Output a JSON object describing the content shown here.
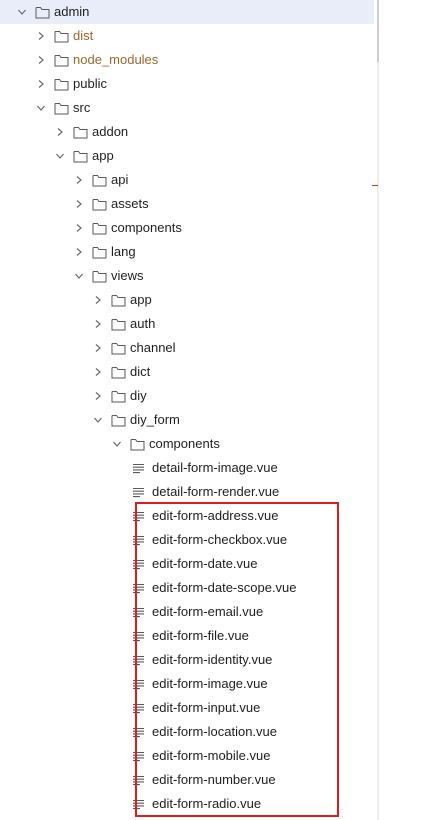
{
  "accent_colors": {
    "selected_row_bg": "#e8edf9",
    "ignored_text": "#a0662b",
    "highlight_border": "#dd1c1c"
  },
  "tree": [
    {
      "label": "admin",
      "type": "folder",
      "depth": 0,
      "expanded": true,
      "selected": true
    },
    {
      "label": "dist",
      "type": "folder",
      "depth": 1,
      "expanded": false,
      "ignored": true
    },
    {
      "label": "node_modules",
      "type": "folder",
      "depth": 1,
      "expanded": false,
      "ignored": true
    },
    {
      "label": "public",
      "type": "folder",
      "depth": 1,
      "expanded": false
    },
    {
      "label": "src",
      "type": "folder",
      "depth": 1,
      "expanded": true
    },
    {
      "label": "addon",
      "type": "folder",
      "depth": 2,
      "expanded": false
    },
    {
      "label": "app",
      "type": "folder",
      "depth": 2,
      "expanded": true
    },
    {
      "label": "api",
      "type": "folder",
      "depth": 3,
      "expanded": false
    },
    {
      "label": "assets",
      "type": "folder",
      "depth": 3,
      "expanded": false
    },
    {
      "label": "components",
      "type": "folder",
      "depth": 3,
      "expanded": false
    },
    {
      "label": "lang",
      "type": "folder",
      "depth": 3,
      "expanded": false
    },
    {
      "label": "views",
      "type": "folder",
      "depth": 3,
      "expanded": true
    },
    {
      "label": "app",
      "type": "folder",
      "depth": 4,
      "expanded": false
    },
    {
      "label": "auth",
      "type": "folder",
      "depth": 4,
      "expanded": false
    },
    {
      "label": "channel",
      "type": "folder",
      "depth": 4,
      "expanded": false
    },
    {
      "label": "dict",
      "type": "folder",
      "depth": 4,
      "expanded": false
    },
    {
      "label": "diy",
      "type": "folder",
      "depth": 4,
      "expanded": false
    },
    {
      "label": "diy_form",
      "type": "folder",
      "depth": 4,
      "expanded": true
    },
    {
      "label": "components",
      "type": "folder",
      "depth": 5,
      "expanded": true
    },
    {
      "label": "detail-form-image.vue",
      "type": "file",
      "depth": 6
    },
    {
      "label": "detail-form-render.vue",
      "type": "file",
      "depth": 6
    },
    {
      "label": "edit-form-address.vue",
      "type": "file",
      "depth": 6
    },
    {
      "label": "edit-form-checkbox.vue",
      "type": "file",
      "depth": 6
    },
    {
      "label": "edit-form-date.vue",
      "type": "file",
      "depth": 6
    },
    {
      "label": "edit-form-date-scope.vue",
      "type": "file",
      "depth": 6
    },
    {
      "label": "edit-form-email.vue",
      "type": "file",
      "depth": 6
    },
    {
      "label": "edit-form-file.vue",
      "type": "file",
      "depth": 6
    },
    {
      "label": "edit-form-identity.vue",
      "type": "file",
      "depth": 6
    },
    {
      "label": "edit-form-image.vue",
      "type": "file",
      "depth": 6
    },
    {
      "label": "edit-form-input.vue",
      "type": "file",
      "depth": 6
    },
    {
      "label": "edit-form-location.vue",
      "type": "file",
      "depth": 6
    },
    {
      "label": "edit-form-mobile.vue",
      "type": "file",
      "depth": 6
    },
    {
      "label": "edit-form-number.vue",
      "type": "file",
      "depth": 6
    },
    {
      "label": "edit-form-radio.vue",
      "type": "file",
      "depth": 6
    }
  ]
}
